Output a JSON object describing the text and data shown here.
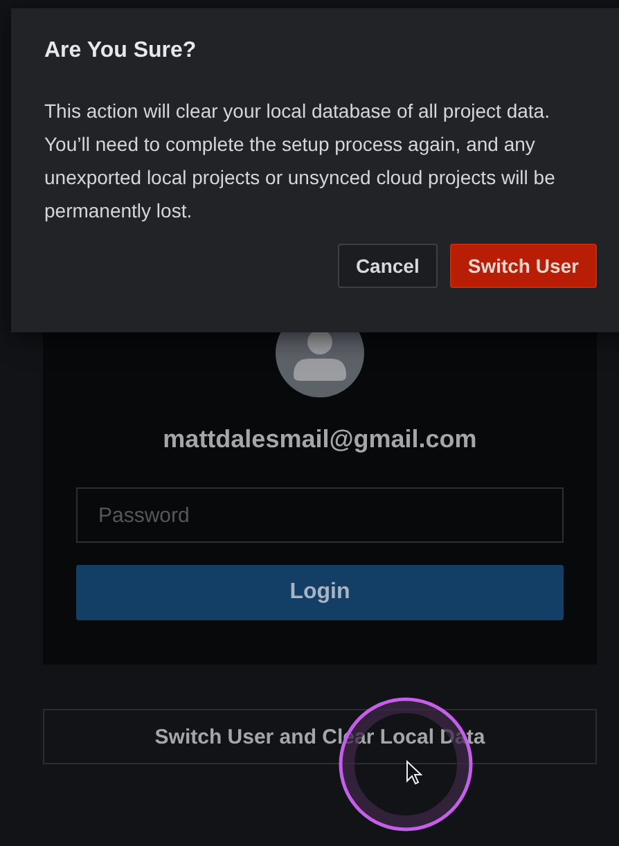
{
  "dialog": {
    "title": "Are You Sure?",
    "message": "This action will clear your local database of all project data. You’ll need to complete the setup process again, and any unexported local projects or unsynced cloud projects will be permanently lost.",
    "buttons": [
      {
        "label": "Cancel",
        "kind": "secondary"
      },
      {
        "label": "Switch User",
        "kind": "danger"
      }
    ]
  },
  "login": {
    "email": "mattdalesmail@gmail.com",
    "password": {
      "placeholder": "Password"
    },
    "login_button": "Login"
  },
  "switch_button": "Switch User and Clear Local Data"
}
